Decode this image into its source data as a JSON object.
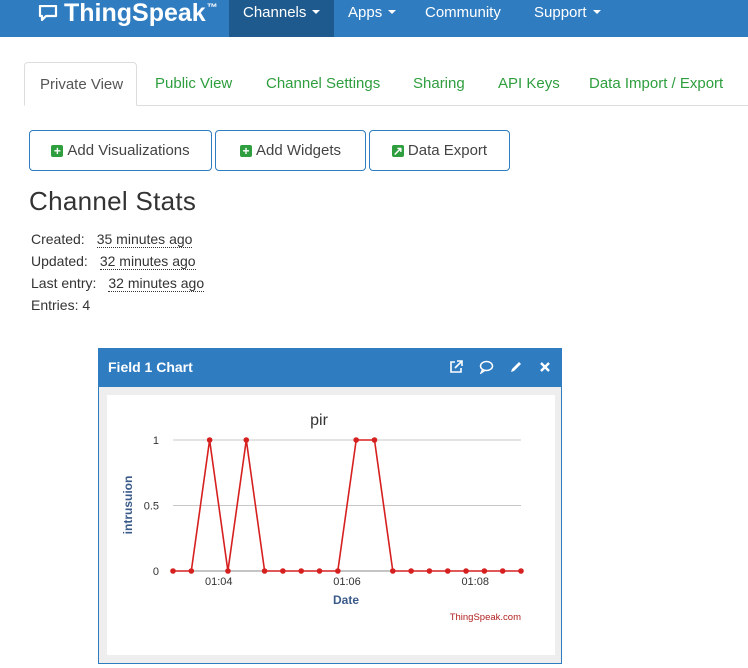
{
  "navbar": {
    "brand": "ThingSpeak",
    "brand_tm": "™",
    "items": [
      {
        "label": "Channels",
        "dropdown": true,
        "active": true
      },
      {
        "label": "Apps",
        "dropdown": true,
        "active": false
      },
      {
        "label": "Community",
        "dropdown": false,
        "active": false
      },
      {
        "label": "Support",
        "dropdown": true,
        "active": false
      }
    ]
  },
  "tabs": [
    {
      "label": "Private View",
      "active": true
    },
    {
      "label": "Public View",
      "active": false
    },
    {
      "label": "Channel Settings",
      "active": false
    },
    {
      "label": "Sharing",
      "active": false
    },
    {
      "label": "API Keys",
      "active": false
    },
    {
      "label": "Data Import / Export",
      "active": false
    }
  ],
  "buttons": {
    "add_visualizations": "Add Visualizations",
    "add_widgets": "Add Widgets",
    "data_export": "Data Export"
  },
  "stats": {
    "title": "Channel Stats",
    "created_label": "Created:",
    "created_value": "35 minutes ago",
    "updated_label": "Updated:",
    "updated_value": "32 minutes ago",
    "last_entry_label": "Last entry:",
    "last_entry_value": "32 minutes ago",
    "entries": "Entries: 4"
  },
  "panel": {
    "title": "Field 1 Chart",
    "icons": [
      "external-link-icon",
      "comment-icon",
      "pencil-icon",
      "close-icon"
    ]
  },
  "colors": {
    "navbar": "#2f7cc0",
    "navbar_active": "#1e5a8e",
    "tab_link": "#2e9e3e",
    "series": "#d62020"
  },
  "chart_data": {
    "type": "line",
    "title": "pir",
    "xlabel": "Date",
    "ylabel": "intrusuion",
    "credit": "ThingSpeak.com",
    "x_ticks": [
      "01:04",
      "01:06",
      "01:08"
    ],
    "x_tick_positions": [
      2.5,
      9.5,
      16.5
    ],
    "y_ticks": [
      "0",
      "0.5",
      "1"
    ],
    "ylim": [
      0,
      1
    ],
    "grid": true,
    "legend": "none",
    "series": [
      {
        "values": [
          0,
          0,
          1,
          0,
          1,
          0,
          0,
          0,
          0,
          0,
          1,
          1,
          0,
          0,
          0,
          0,
          0,
          0,
          0,
          0
        ]
      }
    ]
  }
}
